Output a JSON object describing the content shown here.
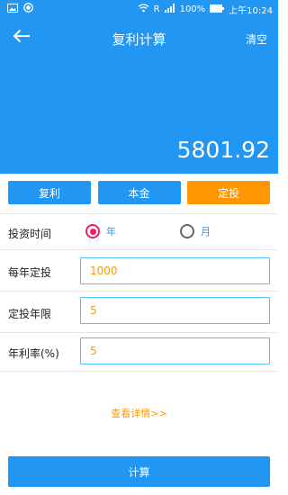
{
  "status_bar": {
    "signal_label": "R",
    "battery": "100%",
    "time": "上午10:24"
  },
  "toolbar": {
    "title": "复利计算",
    "clear_label": "清空"
  },
  "result": "5801.92",
  "tabs": [
    {
      "label": "复利"
    },
    {
      "label": "本金"
    },
    {
      "label": "定投"
    }
  ],
  "form": {
    "period_label": "投资时间",
    "period_options": [
      "年",
      "月"
    ],
    "period_selected": "年",
    "annual_investment_label": "每年定投",
    "annual_investment_value": "1000",
    "years_label": "定投年限",
    "years_value": "5",
    "rate_label": "年利率(%)",
    "rate_value": "5"
  },
  "detail_link": "查看详情>>",
  "calculate_label": "计算",
  "colors": {
    "primary": "#2196f3",
    "accent": "#ff9800",
    "radio_checked": "#e91e63"
  }
}
